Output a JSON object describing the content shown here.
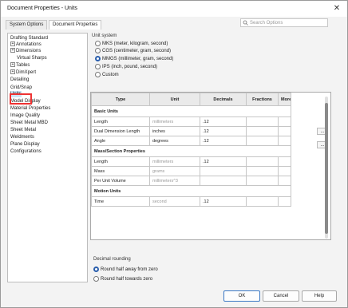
{
  "window": {
    "title": "Document Properties - Units",
    "close_glyph": "✕"
  },
  "tabs": [
    {
      "label": "System Options"
    },
    {
      "label": "Document Properties"
    }
  ],
  "search": {
    "placeholder": "Search Options",
    "icon": "search-icon"
  },
  "tree": {
    "items": [
      {
        "label": "Drafting Standard",
        "indent": false,
        "expander": ""
      },
      {
        "label": "Annotations",
        "indent": false,
        "expander": "+"
      },
      {
        "label": "Dimensions",
        "indent": false,
        "expander": "+"
      },
      {
        "label": "Virtual Sharps",
        "indent": true,
        "expander": ""
      },
      {
        "label": "Tables",
        "indent": false,
        "expander": "+"
      },
      {
        "label": "DimXpert",
        "indent": false,
        "expander": "+"
      },
      {
        "label": "Detailing",
        "indent": false,
        "expander": ""
      },
      {
        "label": "Grid/Snap",
        "indent": false,
        "expander": ""
      },
      {
        "label": "Units",
        "indent": false,
        "expander": "",
        "selected": true
      },
      {
        "label": "Model Display",
        "indent": false,
        "expander": ""
      },
      {
        "label": "Material Properties",
        "indent": false,
        "expander": ""
      },
      {
        "label": "Image Quality",
        "indent": false,
        "expander": ""
      },
      {
        "label": "Sheet Metal MBD",
        "indent": false,
        "expander": ""
      },
      {
        "label": "Sheet Metal",
        "indent": false,
        "expander": ""
      },
      {
        "label": "Weldments",
        "indent": false,
        "expander": ""
      },
      {
        "label": "Plane Display",
        "indent": false,
        "expander": ""
      },
      {
        "label": "Configurations",
        "indent": false,
        "expander": ""
      }
    ]
  },
  "unit_system": {
    "title": "Unit system",
    "options": [
      {
        "label": "MKS  (meter, kilogram, second)",
        "selected": false
      },
      {
        "label": "CGS  (centimeter, gram, second)",
        "selected": false
      },
      {
        "label": "MMGS (millimeter, gram, second)",
        "selected": true
      },
      {
        "label": "IPS  (inch, pound, second)",
        "selected": false
      },
      {
        "label": "Custom",
        "selected": false
      }
    ]
  },
  "units_table": {
    "headers": [
      "Type",
      "Unit",
      "Decimals",
      "Fractions",
      "More"
    ],
    "sections": {
      "basic": "Basic Units",
      "mass": "Mass/Section Properties",
      "motion": "Motion Units"
    },
    "rows": {
      "length": {
        "type": "Length",
        "unit": "millimeters",
        "decimals": ".12"
      },
      "dual": {
        "type": "Dual Dimension Length",
        "unit": "inches",
        "decimals": ".12"
      },
      "angle": {
        "type": "Angle",
        "unit": "degrees",
        "decimals": ".12"
      },
      "mass_length": {
        "type": "Length",
        "unit": "millimeters",
        "decimals": ".12"
      },
      "mass": {
        "type": "Mass",
        "unit": "grams",
        "decimals": ""
      },
      "unit_volume": {
        "type": "Per Unit Volume",
        "unit": "millimeters^3",
        "decimals": ""
      },
      "time": {
        "type": "Time",
        "unit": "second",
        "decimals": ".12"
      }
    },
    "more_glyph": "..."
  },
  "decimal_rounding": {
    "title": "Decimal rounding",
    "options": [
      {
        "label": "Round half away from zero",
        "selected": true
      },
      {
        "label": "Round half towards zero",
        "selected": false
      }
    ]
  },
  "buttons": {
    "ok": "OK",
    "cancel": "Cancel",
    "help": "Help"
  },
  "colors": {
    "accent": "#2b5fad",
    "annotation_box": "#e33333",
    "selection": "#cfe4f6"
  }
}
